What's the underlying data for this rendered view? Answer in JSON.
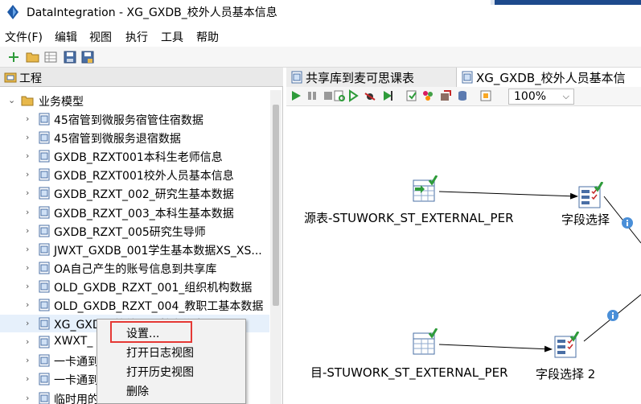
{
  "window": {
    "title": "DataIntegration - XG_GXDB_校外人员基本信息"
  },
  "menubar": {
    "items": [
      "文件(F)",
      "编辑",
      "视图",
      "执行",
      "工具",
      "帮助"
    ]
  },
  "toolbar": {
    "icons": [
      "new-icon",
      "open-folder-icon",
      "explore-icon",
      "save-icon",
      "save-as-icon"
    ]
  },
  "left_panel": {
    "tab_label": "工程",
    "root_label": "业务模型",
    "items": [
      "45宿管到微服务宿管住宿数据",
      "45宿管到微服务退宿数据",
      "GXDB_RZXT001本科生老师信息",
      "GXDB_RZXT001校外人员基本信息",
      "GXDB_RZXT_002_研究生基本数据",
      "GXDB_RZXT_003_本科生基本数据",
      "GXDB_RZXT_005研究生导师",
      "JWXT_GXDB_001学生基本数据XS_XS...",
      "OA自己产生的账号信息到共享库",
      "OLD_GXDB_RZXT_001_组织机构数据",
      "OLD_GXDB_RZXT_004_教职工基本数据",
      "XG_GXDB_校外人员基本信息",
      "XWXT_",
      "一卡通到",
      "一卡通到",
      "临时用的"
    ],
    "selected_index": 11
  },
  "context_menu": {
    "items": [
      "设置...",
      "打开日志视图",
      "打开历史视图",
      "删除"
    ],
    "highlighted_index": 0
  },
  "editor": {
    "tabs": [
      "共享库到麦可思课表",
      "XG_GXDB_校外人员基本信"
    ],
    "active_tab": 1,
    "zoom": "100%",
    "steps": {
      "source1": "源表-STUWORK_ST_EXTERNAL_PER",
      "select1": "字段选择",
      "target2": "目-STUWORK_ST_EXTERNAL_PER",
      "select2": "字段选择 2"
    }
  },
  "colors": {
    "selection": "#e6f0fb",
    "highlight_box": "#e53935",
    "check_green": "#2e9b3a",
    "title_accent": "#1d4a8c"
  }
}
